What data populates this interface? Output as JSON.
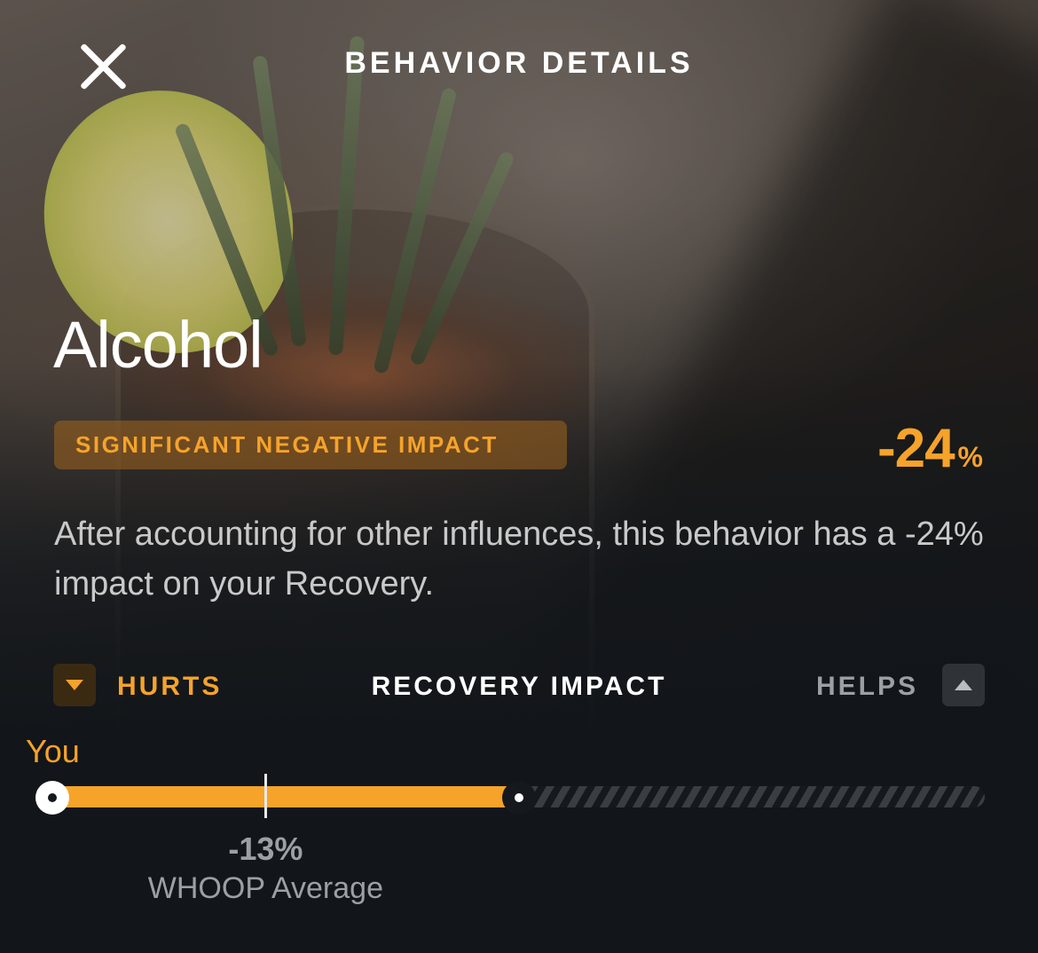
{
  "header": {
    "title": "BEHAVIOR DETAILS"
  },
  "behavior": {
    "name": "Alcohol",
    "badge": "SIGNIFICANT NEGATIVE IMPACT",
    "impact_value": "-24",
    "impact_unit": "%",
    "description": "After accounting for other influences, this behavior has a -24% impact on your Recovery."
  },
  "legend": {
    "hurts_label": "HURTS",
    "title": "RECOVERY IMPACT",
    "helps_label": "HELPS"
  },
  "scale": {
    "you_label": "You",
    "you_fill_fraction": 0.5,
    "average_fraction": 0.228,
    "average_value": "-13%",
    "average_caption": "WHOOP Average"
  },
  "colors": {
    "accent": "#f6a32a",
    "background": "#12161a"
  },
  "icons": {
    "close": "close-icon",
    "hurts": "triangle-down-icon",
    "helps": "triangle-up-icon"
  }
}
